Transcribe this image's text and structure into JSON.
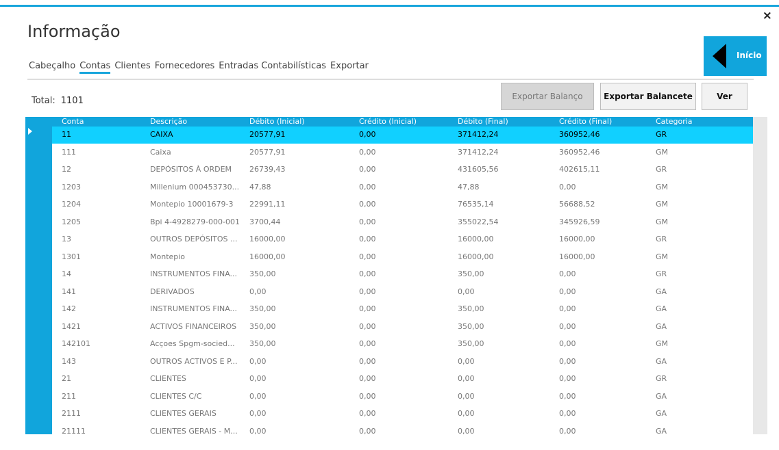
{
  "window": {
    "top_text": "",
    "title": "Informação",
    "close_icon": "×"
  },
  "tabs": [
    {
      "label": "Cabeçalho"
    },
    {
      "label": "Contas"
    },
    {
      "label": "Clientes"
    },
    {
      "label": "Fornecedores"
    },
    {
      "label": "Entradas Contabilísticas"
    },
    {
      "label": "Exportar"
    }
  ],
  "active_tab": "Contas",
  "inicio": {
    "label": "Início",
    "icon": "back-arrow-icon"
  },
  "total": {
    "label": "Total:",
    "value": "1101"
  },
  "toolbar": {
    "exportar_balanco": "Exportar Balanço",
    "exportar_balancete": "Exportar Balancete",
    "ver": "Ver"
  },
  "table": {
    "columns": [
      "Conta",
      "Descrição",
      "Débito (Inicial)",
      "Crédito (Inicial)",
      "Débito (Final)",
      "Crédito (Final)",
      "Categoria"
    ],
    "rows": [
      [
        "11",
        "CAIXA",
        "20577,91",
        "0,00",
        "371412,24",
        "360952,46",
        "GR"
      ],
      [
        "111",
        "Caixa",
        "20577,91",
        "0,00",
        "371412,24",
        "360952,46",
        "GM"
      ],
      [
        "12",
        "DEPÓSITOS À ORDEM",
        "26739,43",
        "0,00",
        "431605,56",
        "402615,11",
        "GR"
      ],
      [
        "1203",
        "Millenium 000453730...",
        "47,88",
        "0,00",
        "47,88",
        "0,00",
        "GM"
      ],
      [
        "1204",
        "Montepio 10001679-3",
        "22991,11",
        "0,00",
        "76535,14",
        "56688,52",
        "GM"
      ],
      [
        "1205",
        "Bpi 4-4928279-000-001",
        "3700,44",
        "0,00",
        "355022,54",
        "345926,59",
        "GM"
      ],
      [
        "13",
        "OUTROS DEPÓSITOS ...",
        "16000,00",
        "0,00",
        "16000,00",
        "16000,00",
        "GR"
      ],
      [
        "1301",
        "Montepio",
        "16000,00",
        "0,00",
        "16000,00",
        "16000,00",
        "GM"
      ],
      [
        "14",
        "INSTRUMENTOS FINA...",
        "350,00",
        "0,00",
        "350,00",
        "0,00",
        "GR"
      ],
      [
        "141",
        "DERIVADOS",
        "0,00",
        "0,00",
        "0,00",
        "0,00",
        "GA"
      ],
      [
        "142",
        "INSTRUMENTOS FINA...",
        "350,00",
        "0,00",
        "350,00",
        "0,00",
        "GA"
      ],
      [
        "1421",
        "ACTIVOS FINANCEIROS",
        "350,00",
        "0,00",
        "350,00",
        "0,00",
        "GA"
      ],
      [
        "142101",
        "Acçoes Spgm-socied...",
        "350,00",
        "0,00",
        "350,00",
        "0,00",
        "GM"
      ],
      [
        "143",
        "OUTROS ACTIVOS E P...",
        "0,00",
        "0,00",
        "0,00",
        "0,00",
        "GA"
      ],
      [
        "21",
        "CLIENTES",
        "0,00",
        "0,00",
        "0,00",
        "0,00",
        "GR"
      ],
      [
        "211",
        "CLIENTES C/C",
        "0,00",
        "0,00",
        "0,00",
        "0,00",
        "GA"
      ],
      [
        "2111",
        "CLIENTES GERAIS",
        "0,00",
        "0,00",
        "0,00",
        "0,00",
        "GA"
      ],
      [
        "21111",
        "CLIENTES GERAIS - M...",
        "0,00",
        "0,00",
        "0,00",
        "0,00",
        "GA"
      ]
    ],
    "selected_row": 0
  },
  "colors": {
    "accent": "#11a5dc",
    "selected_row": "#11d0ff"
  }
}
